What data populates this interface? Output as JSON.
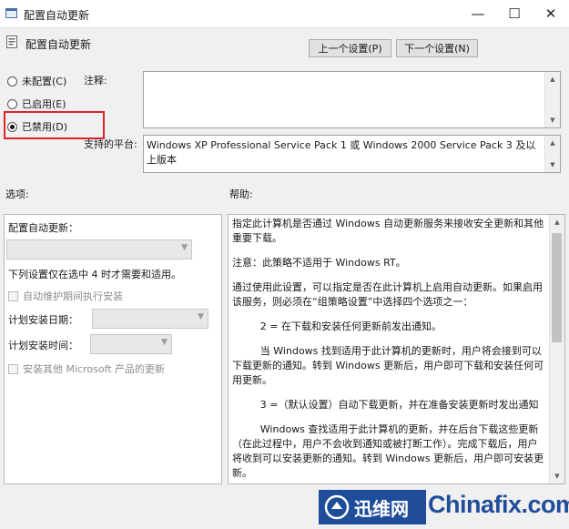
{
  "window": {
    "title": "配置自动更新",
    "minimize": "—",
    "maximize": "☐",
    "close": "✕"
  },
  "header": {
    "policy_title": "配置自动更新",
    "prev_button": "上一个设置(P)",
    "next_button": "下一个设置(N)"
  },
  "state": {
    "options": [
      {
        "label": "未配置(C)",
        "selected": false
      },
      {
        "label": "已启用(E)",
        "selected": false
      },
      {
        "label": "已禁用(D)",
        "selected": true
      }
    ],
    "highlight_color": "#d9242c"
  },
  "comment": {
    "label": "注释:",
    "value": ""
  },
  "platform": {
    "label": "支持的平台:",
    "value": "Windows XP Professional Service Pack 1 或 Windows 2000 Service Pack 3 及以上版本"
  },
  "options_panel": {
    "heading": "选项:",
    "auto_update_label": "配置自动更新：",
    "auto_update_value": "",
    "note": "下列设置仅在选中 4 时才需要和适用。",
    "maintenance_checkbox": "自动维护期间执行安装",
    "schedule_day_label": "计划安装日期：",
    "schedule_day_value": "",
    "schedule_time_label": "计划安装时间：",
    "schedule_time_value": "",
    "other_products_checkbox": "安装其他 Microsoft 产品的更新"
  },
  "help_panel": {
    "heading": "帮助:",
    "paragraphs": [
      "指定此计算机是否通过 Windows 自动更新服务来接收安全更新和其他重要下载。",
      "注意：此策略不适用于 Windows RT。",
      "通过使用此设置，可以指定是否在此计算机上启用自动更新。如果启用该服务，则必须在“组策略设置”中选择四个选项之一：",
      "2 = 在下载和安装任何更新前发出通知。",
      "当 Windows 找到适用于此计算机的更新时，用户将会接到可以下载更新的通知。转到 Windows 更新后，用户即可下载和安装任何可用更新。",
      "3 =（默认设置）自动下载更新，并在准备安装更新时发出通知",
      "Windows 查找适用于此计算机的更新，并在后台下载这些更新（在此过程中，用户不会收到通知或被打断工作）。完成下载后，用户将收到可以安装更新的通知。转到 Windows 更新后，用户即可安装更新。"
    ]
  },
  "watermark": {
    "brand": "迅维网",
    "site": "Chinafix.com",
    "color": "#1f4d9a"
  }
}
